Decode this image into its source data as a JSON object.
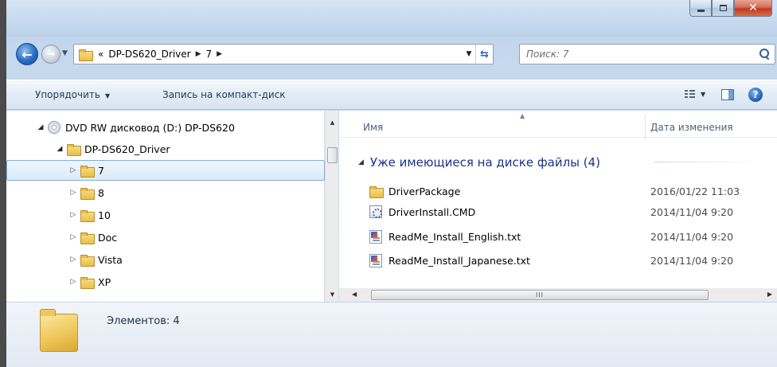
{
  "window": {
    "caption_buttons": {
      "minimize": "minimize-icon",
      "maximize": "maximize-icon",
      "close": "close-icon"
    }
  },
  "nav": {
    "back": "back-arrow-icon",
    "forward": "forward-arrow-icon",
    "breadcrumb_overflow": "«",
    "breadcrumbs": [
      "DP-DS620_Driver",
      "7"
    ]
  },
  "search": {
    "placeholder": "Поиск: 7"
  },
  "toolbar": {
    "organize_label": "Упорядочить",
    "burn_label": "Запись на компакт-диск"
  },
  "tree": {
    "drive_label": "DVD RW дисковод (D:) DP-DS620",
    "root_folder": "DP-DS620_Driver",
    "folders": [
      "7",
      "8",
      "10",
      "Doc",
      "Vista",
      "XP"
    ],
    "selected": "7"
  },
  "content": {
    "columns": {
      "name": "Имя",
      "date": "Дата изменения"
    },
    "group_title": "Уже имеющиеся на диске файлы (4)",
    "files": [
      {
        "name": "DriverPackage",
        "date": "2016/01/22 11:03",
        "icon": "folder-icon"
      },
      {
        "name": "DriverInstall.CMD",
        "date": "2014/11/04 9:20",
        "icon": "cmd-file-icon"
      },
      {
        "name": "ReadMe_Install_English.txt",
        "date": "2014/11/04 9:20",
        "icon": "text-file-icon"
      },
      {
        "name": "ReadMe_Install_Japanese.txt",
        "date": "2014/11/04 9:20",
        "icon": "text-file-icon"
      }
    ],
    "hscroll_grip": "III"
  },
  "details": {
    "items_count": "Элементов: 4"
  },
  "colors": {
    "accent": "#1e3287",
    "toolbar_text": "#1e395b",
    "selection_border": "#84acdd",
    "close_button": "#c0391f"
  }
}
